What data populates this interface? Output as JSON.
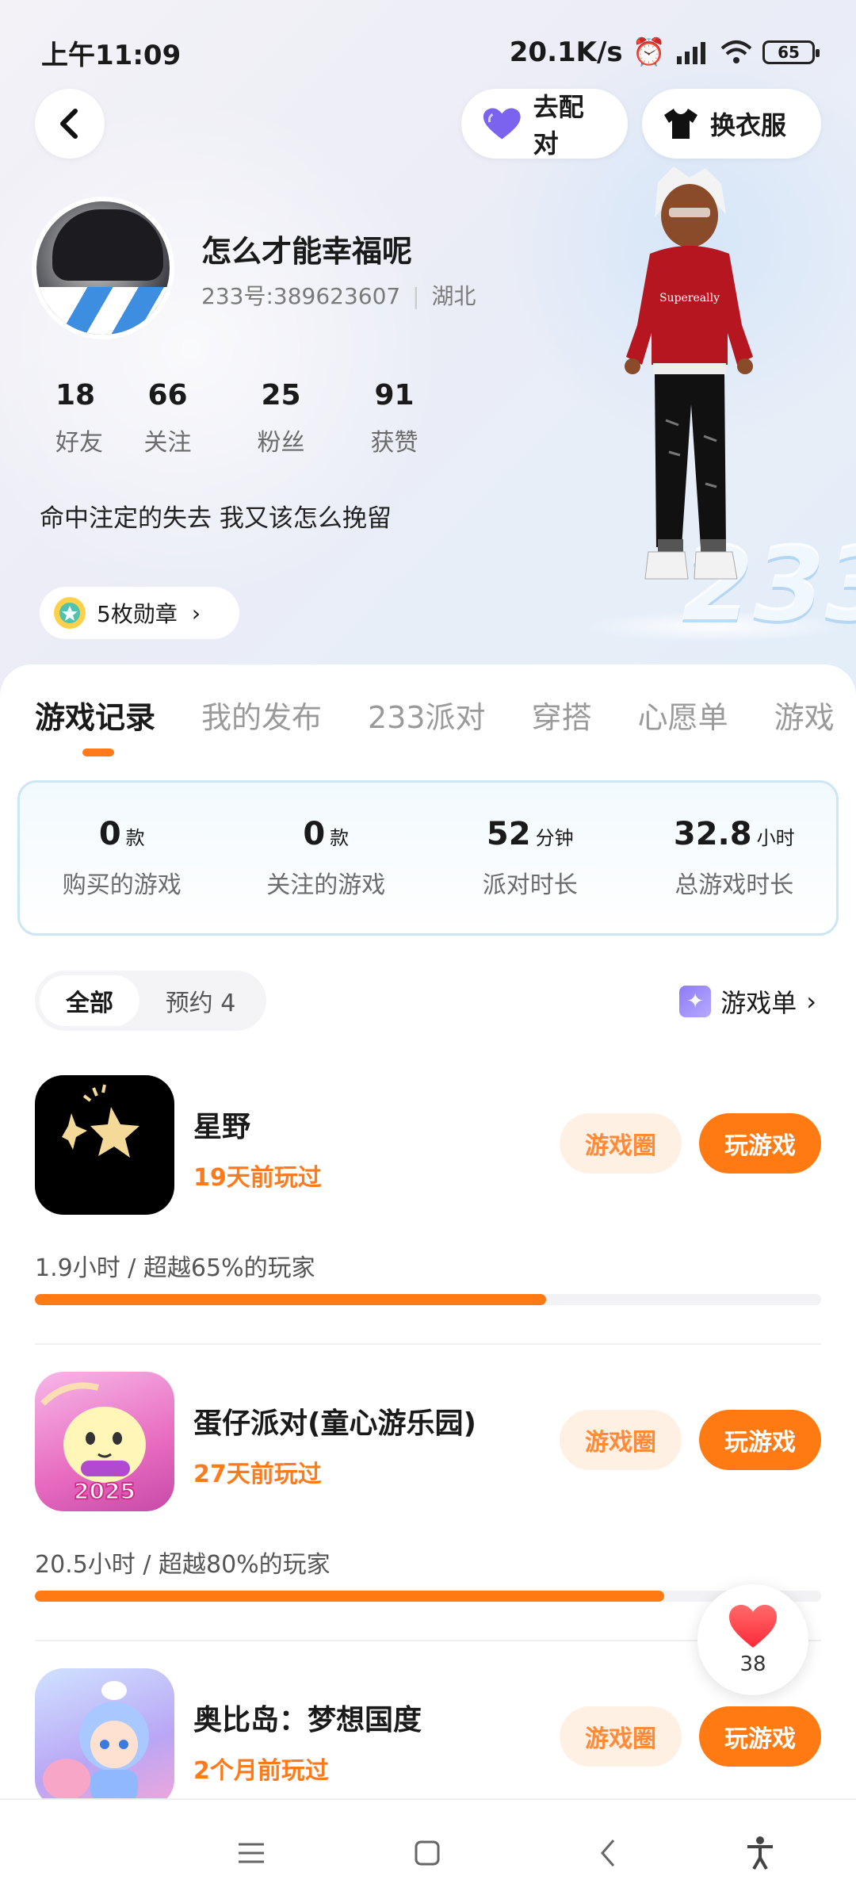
{
  "status_bar": {
    "time": "上午11:09",
    "speed": "20.1K/s",
    "battery": "65"
  },
  "header": {
    "match_label": "去配对",
    "dress_label": "换衣服"
  },
  "profile": {
    "username": "怎么才能幸福呢",
    "id_line": "233号:389623607",
    "location": "湖北",
    "stats": [
      {
        "value": "18",
        "label": "好友"
      },
      {
        "value": "66",
        "label": "关注"
      },
      {
        "value": "25",
        "label": "粉丝"
      },
      {
        "value": "91",
        "label": "获赞"
      }
    ],
    "bio": "命中注定的失去 我又该怎么挽留",
    "badges_label": "5枚勋章",
    "character_text": "Supereally"
  },
  "tabs": [
    "游戏记录",
    "我的发布",
    "233派对",
    "穿搭",
    "心愿单",
    "游戏"
  ],
  "summary": [
    {
      "value": "0",
      "unit": "款",
      "label": "购买的游戏"
    },
    {
      "value": "0",
      "unit": "款",
      "label": "关注的游戏"
    },
    {
      "value": "52",
      "unit": "分钟",
      "label": "派对时长"
    },
    {
      "value": "32.8",
      "unit": "小时",
      "label": "总游戏时长"
    }
  ],
  "filter": {
    "all": "全部",
    "reserve": "预约 4",
    "gamelist": "游戏单"
  },
  "games": [
    {
      "name": "星野",
      "played": "19天前玩过",
      "meta": "1.9小时 / 超越65%的玩家",
      "progress": 0.65,
      "circle_label": "游戏圈",
      "play_label": "玩游戏"
    },
    {
      "name": "蛋仔派对(童心游乐园)",
      "played": "27天前玩过",
      "meta": "20.5小时 / 超越80%的玩家",
      "progress": 0.8,
      "circle_label": "游戏圈",
      "play_label": "玩游戏",
      "icon_text": "2025"
    },
    {
      "name": "奥比岛：梦想国度",
      "played": "2个月前玩过",
      "circle_label": "游戏圈",
      "play_label": "玩游戏"
    }
  ],
  "like_count": "38",
  "colors": {
    "accent": "#ff7a12",
    "accent_light": "#fff0e4",
    "purple": "#7b63f0"
  }
}
